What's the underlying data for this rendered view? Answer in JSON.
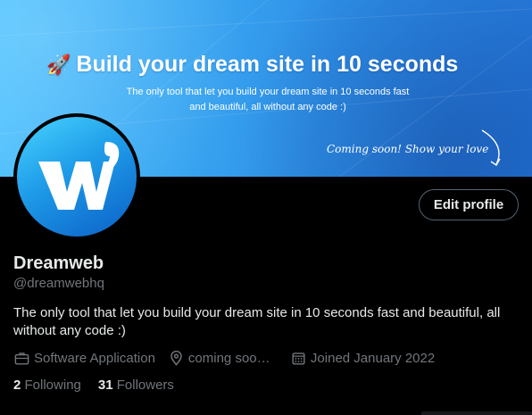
{
  "banner": {
    "headline": "Build your dream site in 10 seconds",
    "headline_icon": "rocket-icon",
    "subtitle_line1": "The only tool that let you build your dream site in 10 seconds fast",
    "subtitle_line2": "and beautiful, all without any code :)",
    "cta": "Coming soon! Show your love",
    "colors": {
      "start": "#4fc3ff",
      "end": "#2477da"
    }
  },
  "profile": {
    "avatar_icon": "dreamweb-w-logo",
    "edit_button": "Edit profile",
    "name": "Dreamweb",
    "handle": "@dreamwebhq",
    "bio": "The only tool that let you build your dream site in 10 seconds fast and beautiful, all without any code :)",
    "category": "Software Application",
    "category_icon": "briefcase-icon",
    "location": "coming soon…",
    "location_icon": "location-pin-icon",
    "joined": "Joined January 2022",
    "joined_icon": "calendar-icon",
    "following_count": "2",
    "following_label": "Following",
    "followers_count": "31",
    "followers_label": "Followers"
  },
  "theme": {
    "background": "#000000",
    "text": "#e7e9ea",
    "muted": "#71767b",
    "border": "#536471"
  }
}
